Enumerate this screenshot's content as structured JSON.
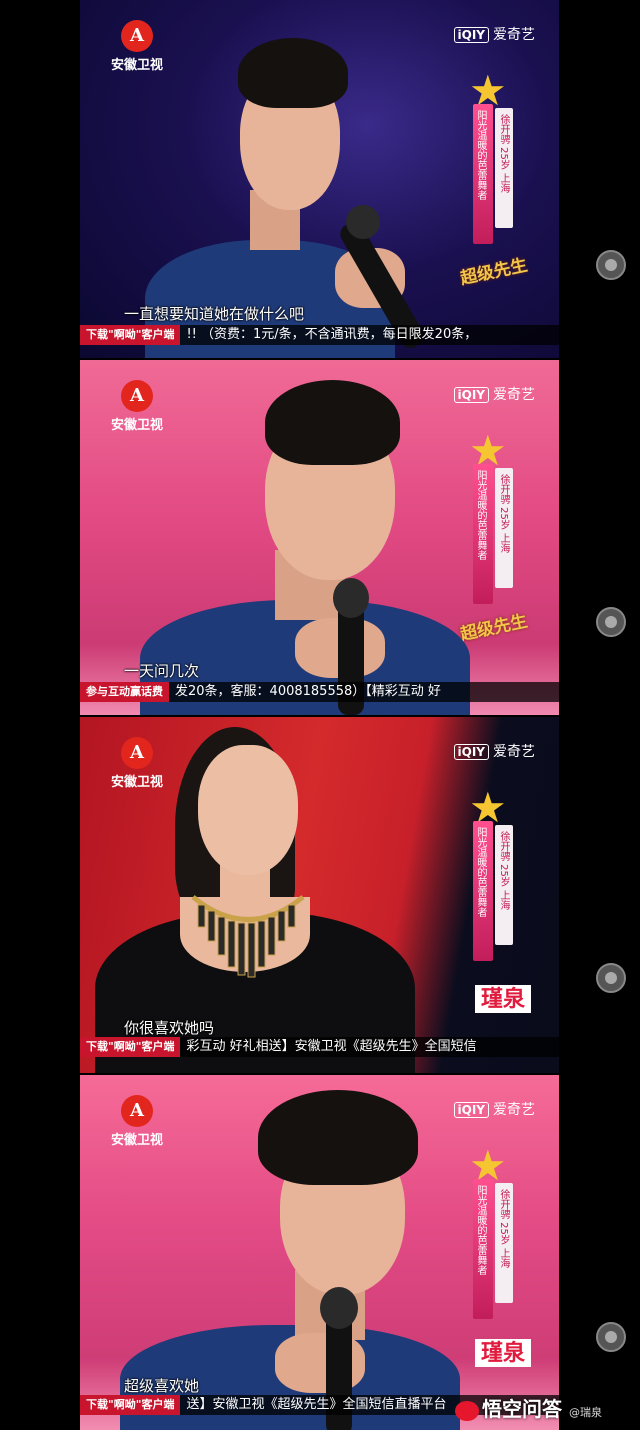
{
  "station": {
    "logo_char": "A",
    "name": "安徽卫视"
  },
  "watermark": {
    "brand_box": "iQIY",
    "brand_text": "爱奇艺"
  },
  "contestant_banner": {
    "slogan": "阳光温暖的芭蕾舞者",
    "info": "徐开骋 25岁 上海"
  },
  "show_logo": "超级先生",
  "frames": [
    {
      "subtitle": "一直想要知道她在做什么吧",
      "ticker_tag": "下载\"啊呦\"客户端",
      "ticker_text": "!! （资费：1元/条，不含通讯费，每日限发20条，"
    },
    {
      "subtitle": "一天问几次",
      "ticker_tag": "参与互动赢话费",
      "ticker_text": "发20条，客服：4008185558）【精彩互动 好"
    },
    {
      "subtitle": "你很喜欢她吗",
      "ticker_tag": "下载\"啊呦\"客户端",
      "ticker_text": "彩互动 好礼相送】安徽卫视《超级先生》全国短信",
      "namecard": "瑾泉"
    },
    {
      "subtitle": "超级喜欢她",
      "ticker_tag": "下载\"啊呦\"客户端",
      "ticker_text": "送】安徽卫视《超级先生》全国短信直播平台",
      "namecard": "瑾泉"
    }
  ],
  "overlay": {
    "weibo_text": "悟空问答",
    "weibo_sub": "@瑞泉"
  },
  "colors": {
    "station_red": "#e2261e",
    "banner_pink": "#ff4f8f",
    "ticker_red": "#c8142c"
  }
}
